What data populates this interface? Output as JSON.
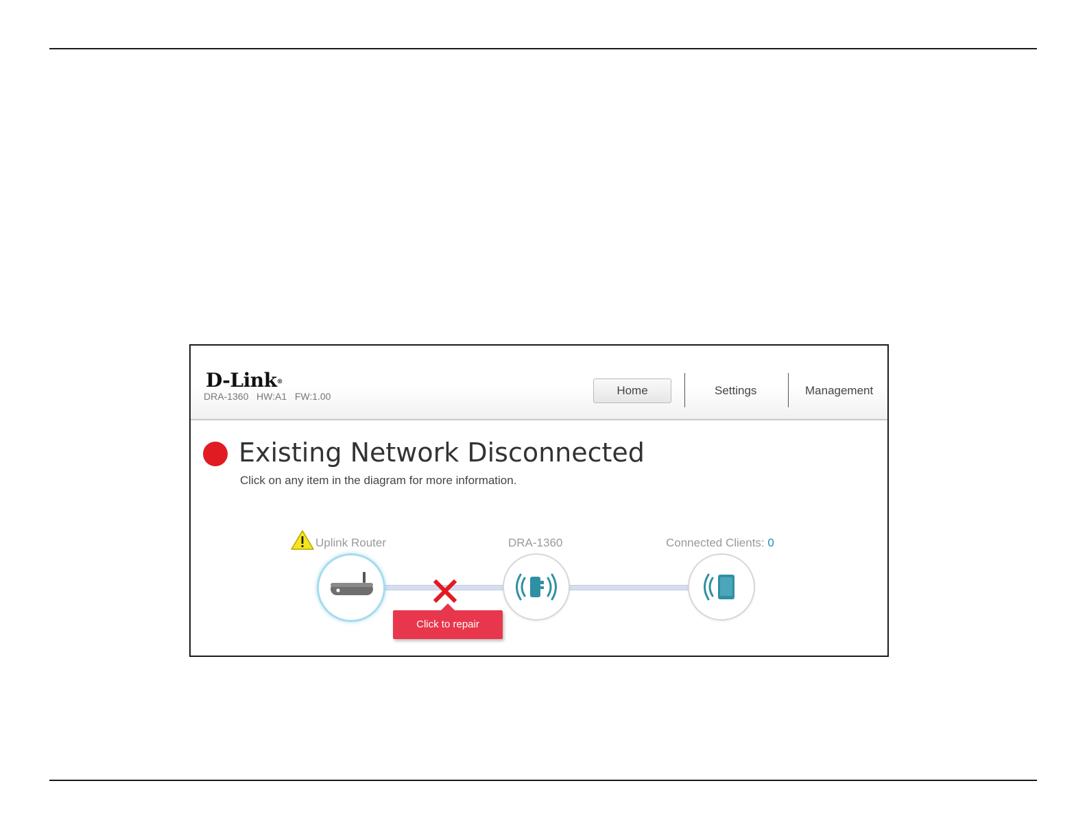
{
  "brand": {
    "logo": "D-Link",
    "registered": "®"
  },
  "device": {
    "model": "DRA-1360",
    "hw": "HW:A1",
    "fw": "FW:1.00"
  },
  "nav": {
    "items": [
      "Home",
      "Settings",
      "Management"
    ]
  },
  "status": {
    "title": "Existing Network Disconnected",
    "subtitle": "Click on any item in the diagram for more information.",
    "color": "#e11b22"
  },
  "diagram": {
    "uplink_label": "Uplink Router",
    "extender_label": "DRA-1360",
    "clients_label": "Connected Clients: ",
    "clients_count": "0",
    "repair_label": "Click to repair",
    "accent": "#2f8fa3",
    "alert_color": "#e8374c"
  },
  "icons": {
    "warning": "warning-triangle-icon",
    "router": "router-icon",
    "extender": "extender-wireless-icon",
    "client": "tablet-wireless-icon",
    "disconnect": "red-x-icon"
  }
}
